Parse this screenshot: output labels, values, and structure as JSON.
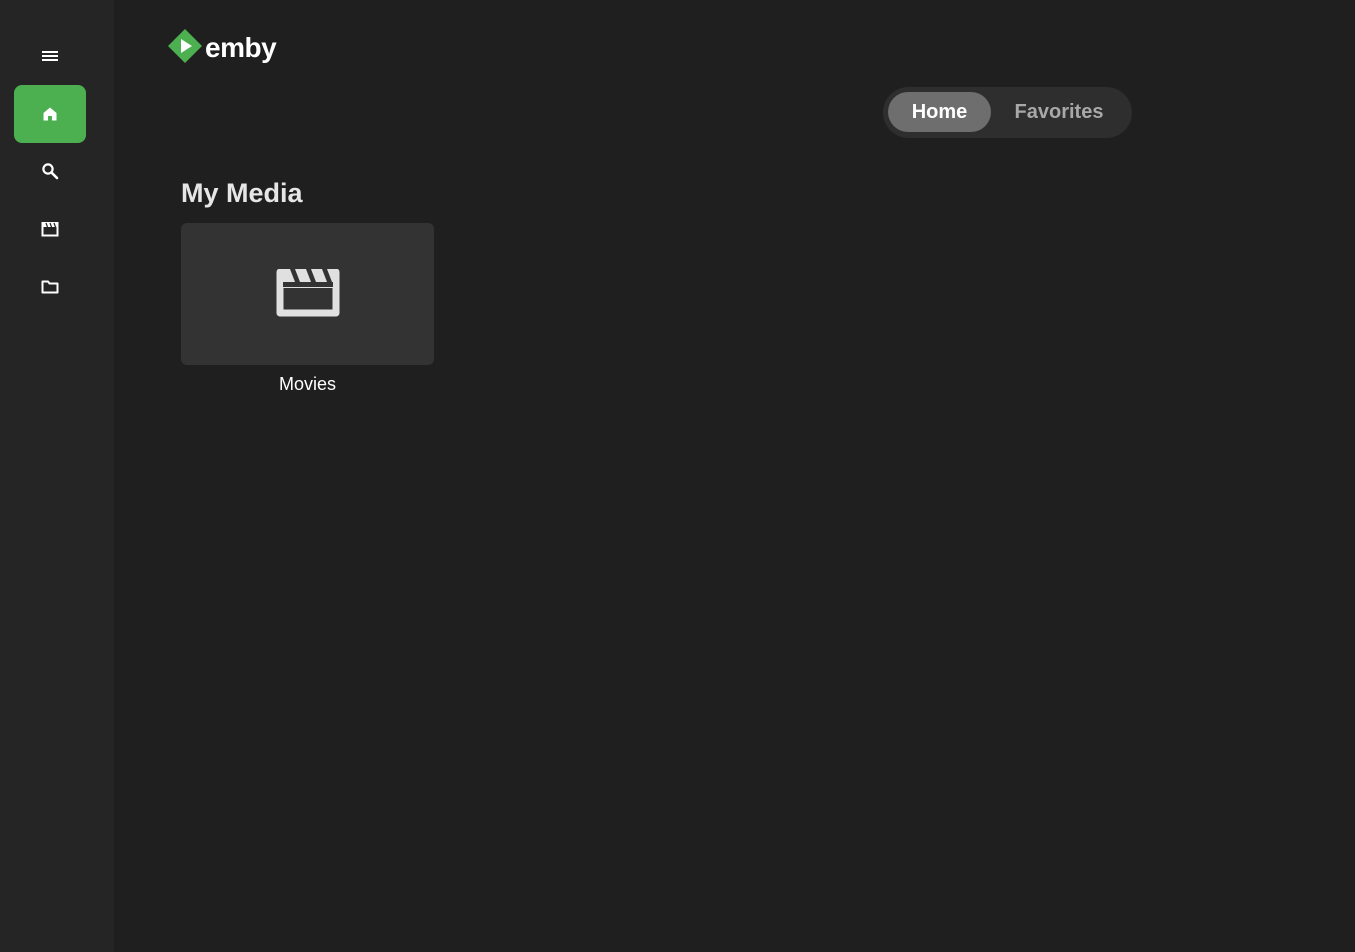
{
  "app": {
    "brand_name": "emby",
    "brand_color": "#4caf50"
  },
  "sidebar": {
    "items": [
      {
        "name": "menu",
        "icon": "menu-icon"
      },
      {
        "name": "home",
        "icon": "home-icon",
        "active": true
      },
      {
        "name": "search",
        "icon": "search-icon"
      },
      {
        "name": "movies",
        "icon": "movie-icon"
      },
      {
        "name": "folders",
        "icon": "folder-icon"
      }
    ]
  },
  "header": {
    "tabs": [
      {
        "label": "Home",
        "active": true
      },
      {
        "label": "Favorites",
        "active": false
      }
    ]
  },
  "main": {
    "section_title": "My Media",
    "libraries": [
      {
        "label": "Movies",
        "icon": "movie-icon"
      }
    ]
  },
  "colors": {
    "background": "#1f1f1f",
    "sidebar": "#252525",
    "card": "#333333",
    "accent": "#4caf50"
  }
}
